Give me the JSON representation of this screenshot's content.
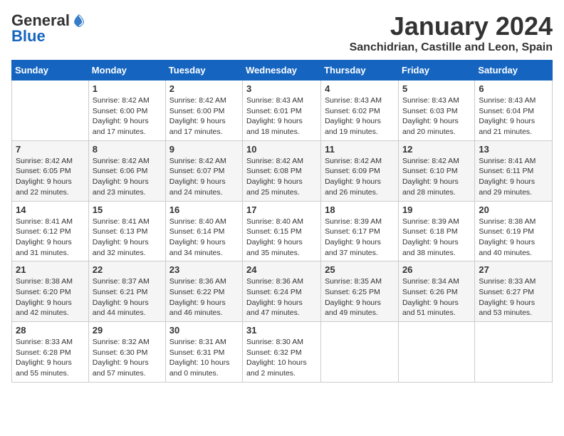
{
  "header": {
    "logo_line1": "General",
    "logo_line2": "Blue",
    "month": "January 2024",
    "location": "Sanchidrian, Castille and Leon, Spain"
  },
  "weekdays": [
    "Sunday",
    "Monday",
    "Tuesday",
    "Wednesday",
    "Thursday",
    "Friday",
    "Saturday"
  ],
  "weeks": [
    [
      {
        "day": "",
        "info": ""
      },
      {
        "day": "1",
        "info": "Sunrise: 8:42 AM\nSunset: 6:00 PM\nDaylight: 9 hours\nand 17 minutes."
      },
      {
        "day": "2",
        "info": "Sunrise: 8:42 AM\nSunset: 6:00 PM\nDaylight: 9 hours\nand 17 minutes."
      },
      {
        "day": "3",
        "info": "Sunrise: 8:43 AM\nSunset: 6:01 PM\nDaylight: 9 hours\nand 18 minutes."
      },
      {
        "day": "4",
        "info": "Sunrise: 8:43 AM\nSunset: 6:02 PM\nDaylight: 9 hours\nand 19 minutes."
      },
      {
        "day": "5",
        "info": "Sunrise: 8:43 AM\nSunset: 6:03 PM\nDaylight: 9 hours\nand 20 minutes."
      },
      {
        "day": "6",
        "info": "Sunrise: 8:43 AM\nSunset: 6:04 PM\nDaylight: 9 hours\nand 21 minutes."
      }
    ],
    [
      {
        "day": "7",
        "info": "Sunrise: 8:42 AM\nSunset: 6:05 PM\nDaylight: 9 hours\nand 22 minutes."
      },
      {
        "day": "8",
        "info": "Sunrise: 8:42 AM\nSunset: 6:06 PM\nDaylight: 9 hours\nand 23 minutes."
      },
      {
        "day": "9",
        "info": "Sunrise: 8:42 AM\nSunset: 6:07 PM\nDaylight: 9 hours\nand 24 minutes."
      },
      {
        "day": "10",
        "info": "Sunrise: 8:42 AM\nSunset: 6:08 PM\nDaylight: 9 hours\nand 25 minutes."
      },
      {
        "day": "11",
        "info": "Sunrise: 8:42 AM\nSunset: 6:09 PM\nDaylight: 9 hours\nand 26 minutes."
      },
      {
        "day": "12",
        "info": "Sunrise: 8:42 AM\nSunset: 6:10 PM\nDaylight: 9 hours\nand 28 minutes."
      },
      {
        "day": "13",
        "info": "Sunrise: 8:41 AM\nSunset: 6:11 PM\nDaylight: 9 hours\nand 29 minutes."
      }
    ],
    [
      {
        "day": "14",
        "info": "Sunrise: 8:41 AM\nSunset: 6:12 PM\nDaylight: 9 hours\nand 31 minutes."
      },
      {
        "day": "15",
        "info": "Sunrise: 8:41 AM\nSunset: 6:13 PM\nDaylight: 9 hours\nand 32 minutes."
      },
      {
        "day": "16",
        "info": "Sunrise: 8:40 AM\nSunset: 6:14 PM\nDaylight: 9 hours\nand 34 minutes."
      },
      {
        "day": "17",
        "info": "Sunrise: 8:40 AM\nSunset: 6:15 PM\nDaylight: 9 hours\nand 35 minutes."
      },
      {
        "day": "18",
        "info": "Sunrise: 8:39 AM\nSunset: 6:17 PM\nDaylight: 9 hours\nand 37 minutes."
      },
      {
        "day": "19",
        "info": "Sunrise: 8:39 AM\nSunset: 6:18 PM\nDaylight: 9 hours\nand 38 minutes."
      },
      {
        "day": "20",
        "info": "Sunrise: 8:38 AM\nSunset: 6:19 PM\nDaylight: 9 hours\nand 40 minutes."
      }
    ],
    [
      {
        "day": "21",
        "info": "Sunrise: 8:38 AM\nSunset: 6:20 PM\nDaylight: 9 hours\nand 42 minutes."
      },
      {
        "day": "22",
        "info": "Sunrise: 8:37 AM\nSunset: 6:21 PM\nDaylight: 9 hours\nand 44 minutes."
      },
      {
        "day": "23",
        "info": "Sunrise: 8:36 AM\nSunset: 6:22 PM\nDaylight: 9 hours\nand 46 minutes."
      },
      {
        "day": "24",
        "info": "Sunrise: 8:36 AM\nSunset: 6:24 PM\nDaylight: 9 hours\nand 47 minutes."
      },
      {
        "day": "25",
        "info": "Sunrise: 8:35 AM\nSunset: 6:25 PM\nDaylight: 9 hours\nand 49 minutes."
      },
      {
        "day": "26",
        "info": "Sunrise: 8:34 AM\nSunset: 6:26 PM\nDaylight: 9 hours\nand 51 minutes."
      },
      {
        "day": "27",
        "info": "Sunrise: 8:33 AM\nSunset: 6:27 PM\nDaylight: 9 hours\nand 53 minutes."
      }
    ],
    [
      {
        "day": "28",
        "info": "Sunrise: 8:33 AM\nSunset: 6:28 PM\nDaylight: 9 hours\nand 55 minutes."
      },
      {
        "day": "29",
        "info": "Sunrise: 8:32 AM\nSunset: 6:30 PM\nDaylight: 9 hours\nand 57 minutes."
      },
      {
        "day": "30",
        "info": "Sunrise: 8:31 AM\nSunset: 6:31 PM\nDaylight: 10 hours\nand 0 minutes."
      },
      {
        "day": "31",
        "info": "Sunrise: 8:30 AM\nSunset: 6:32 PM\nDaylight: 10 hours\nand 2 minutes."
      },
      {
        "day": "",
        "info": ""
      },
      {
        "day": "",
        "info": ""
      },
      {
        "day": "",
        "info": ""
      }
    ]
  ]
}
